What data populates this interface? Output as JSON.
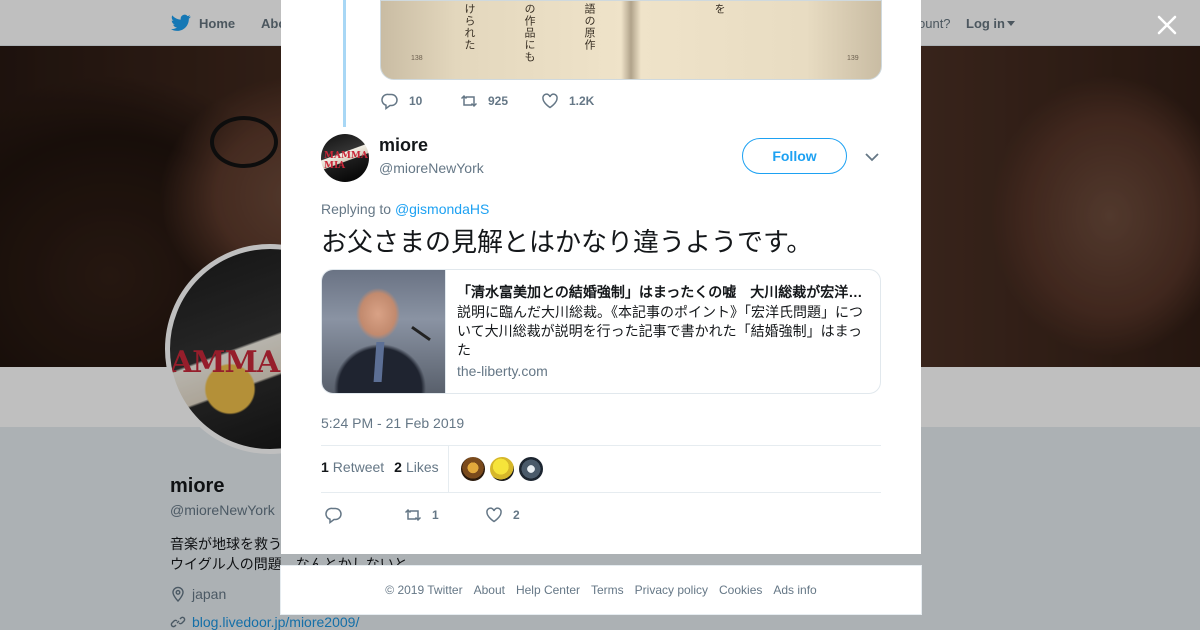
{
  "nav": {
    "home_label": "Home",
    "about_label": "Abo",
    "account_prompt": "ccount?",
    "login_label": "Log in"
  },
  "background_profile": {
    "avatar_text": "AMMA MIA!",
    "name": "miore",
    "handle": "@mioreNewYork",
    "bio_line1": "音楽が地球を救う",
    "bio_line2": "ウイグル人の問題　なんとかしないと",
    "location": "japan",
    "link": "blog.livedoor.jp/miore2009/"
  },
  "previous_tweet": {
    "media_text": [
      "けられた",
      "の作品にも",
      "語の原作",
      "を"
    ],
    "page_left": "138",
    "page_right": "139",
    "actions": {
      "replies": "10",
      "retweets": "925",
      "likes": "1.2K"
    }
  },
  "tweet": {
    "author_avatar_text": "MAMMA MIA",
    "author_name": "miore",
    "author_handle": "@mioreNewYork",
    "follow_label": "Follow",
    "replying_prefix": "Replying to ",
    "replying_to": "@gismondaHS",
    "text": "お父さまの見解とはかなり違うようです。",
    "card": {
      "title": "「清水富美加との結婚強制」はまったくの嘘　大川総裁が宏洋氏の「虚偽」に反論",
      "description": "説明に臨んだ大川総裁。《本記事のポイント》「宏洋氏問題」について大川総裁が説明を行った記事で書かれた「結婚強制」はまった",
      "domain": "the-liberty.com"
    },
    "timestamp": "5:24 PM - 21 Feb 2019",
    "stats": {
      "retweet_count": "1",
      "retweet_label": "Retweet",
      "like_count": "2",
      "like_label": "Likes"
    },
    "actions": {
      "replies": "",
      "retweets": "1",
      "likes": "2"
    }
  },
  "footer": {
    "links": [
      "© 2019 Twitter",
      "About",
      "Help Center",
      "Terms",
      "Privacy policy",
      "Cookies",
      "Ads info"
    ]
  },
  "colors": {
    "accent": "#1da1f2",
    "muted_text": "#657786",
    "thread_line": "#a8d7f5"
  }
}
